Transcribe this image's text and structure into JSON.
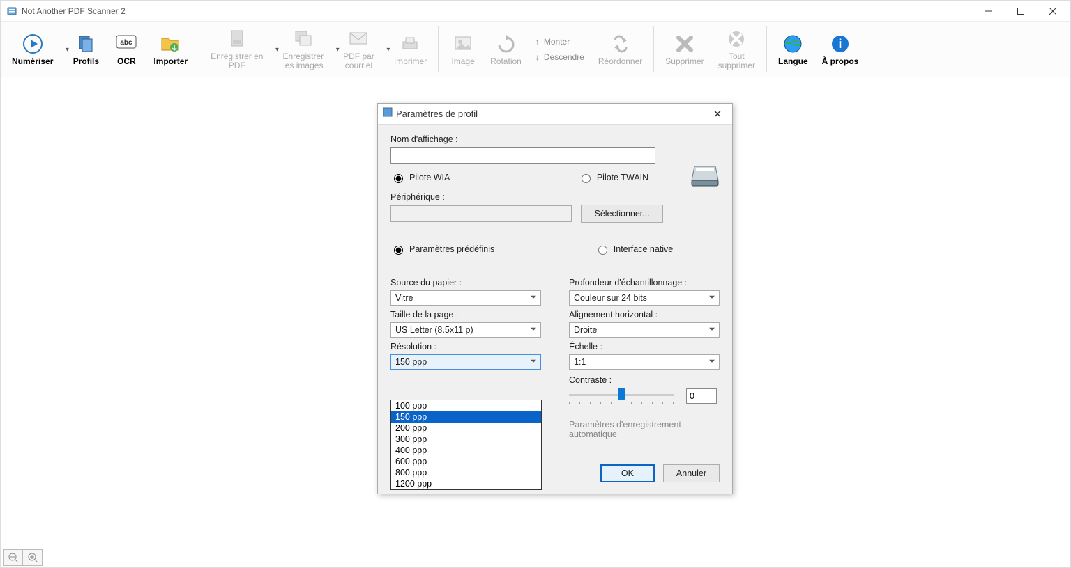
{
  "window": {
    "title": "Not Another PDF Scanner 2"
  },
  "toolbar": {
    "scan": "Numériser",
    "profiles": "Profils",
    "ocr": "OCR",
    "import": "Importer",
    "save_pdf": "Enregistrer en\nPDF",
    "save_images": "Enregistrer\nles images",
    "pdf_email": "PDF par\ncourriel",
    "print": "Imprimer",
    "image": "Image",
    "rotate": "Rotation",
    "move_up": "Monter",
    "move_down": "Descendre",
    "reorder": "Réordonner",
    "delete": "Supprimer",
    "delete_all": "Tout\nsupprimer",
    "lang": "Langue",
    "about": "À propos"
  },
  "dialog": {
    "title": "Paramètres de profil",
    "display_name_label": "Nom d'affichage :",
    "display_name_value": "",
    "driver_wia": "Pilote WIA",
    "driver_twain": "Pilote TWAIN",
    "device_label": "Périphérique :",
    "device_value": "",
    "select_btn": "Sélectionner...",
    "preset_params": "Paramètres prédéfinis",
    "native_interface": "Interface native",
    "paper_source_label": "Source du papier :",
    "paper_source_value": "Vitre",
    "page_size_label": "Taille de la page :",
    "page_size_value": "US Letter (8.5x11 p)",
    "resolution_label": "Résolution :",
    "resolution_value": "150 ppp",
    "resolution_options": [
      "100 ppp",
      "150 ppp",
      "200 ppp",
      "300 ppp",
      "400 ppp",
      "600 ppp",
      "800 ppp",
      "1200 ppp"
    ],
    "bit_depth_label": "Profondeur d'échantillonnage :",
    "bit_depth_value": "Couleur sur 24 bits",
    "halign_label": "Alignement horizontal :",
    "halign_value": "Droite",
    "scale_label": "Échelle :",
    "scale_value": "1:1",
    "contrast_label": "Contraste :",
    "contrast_value": "0",
    "autosave_label": "Paramètres d'enregistrement automatique",
    "ok": "OK",
    "cancel": "Annuler"
  }
}
